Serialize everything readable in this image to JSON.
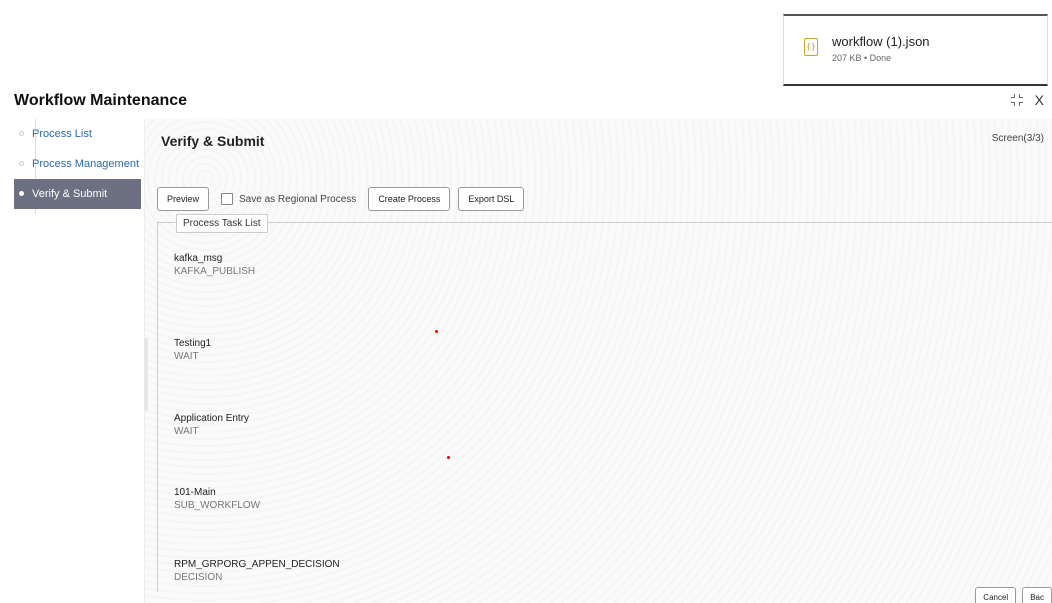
{
  "download": {
    "file_name": "workflow (1).json",
    "status": "207 KB • Done",
    "icon": "file-icon"
  },
  "page": {
    "title": "Workflow Maintenance",
    "close_label": "X"
  },
  "sidebar": {
    "items": [
      {
        "label": "Process List",
        "active": false
      },
      {
        "label": "Process Management",
        "active": false
      },
      {
        "label": "Verify & Submit",
        "active": true
      }
    ]
  },
  "main": {
    "title": "Verify & Submit",
    "screen_indicator": "Screen(3/3)",
    "toolbar": {
      "preview_label": "Preview",
      "regional_label": "Save as Regional Process",
      "create_label": "Create Process",
      "export_label": "Export DSL"
    },
    "task_list": {
      "legend": "Process Task List",
      "tasks": [
        {
          "name": "kafka_msg",
          "type": "KAFKA_PUBLISH"
        },
        {
          "name": "Testing1",
          "type": "WAIT"
        },
        {
          "name": "Application Entry",
          "type": "WAIT"
        },
        {
          "name": "101-Main",
          "type": "SUB_WORKFLOW"
        },
        {
          "name": "RPM_GRPORG_APPEN_DECISION",
          "type": "DECISION"
        }
      ]
    }
  },
  "footer": {
    "cancel_label": "Cancel",
    "back_label": "Bac"
  },
  "colors": {
    "accent_link": "#2b6aa8",
    "active_nav": "#6d6f82"
  }
}
